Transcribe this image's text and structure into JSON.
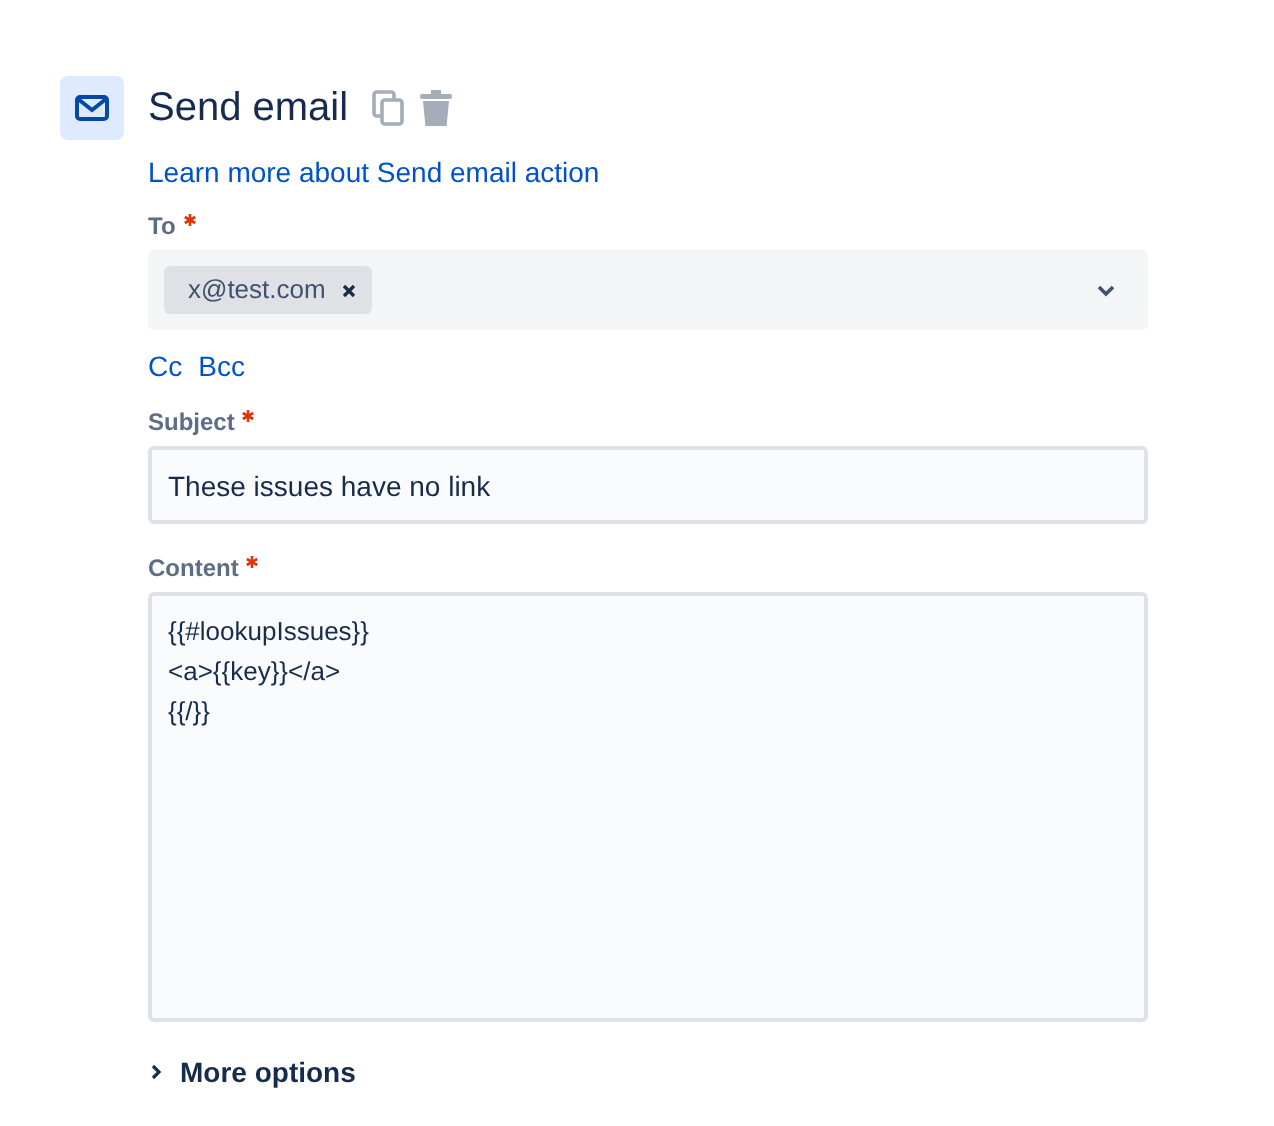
{
  "action": {
    "title": "Send email",
    "help_link": "Learn more about Send email action"
  },
  "to": {
    "label": "To",
    "required": true,
    "recipients": [
      "x@test.com"
    ]
  },
  "copy_links": [
    "Cc",
    "Bcc"
  ],
  "subject": {
    "label": "Subject",
    "required": true,
    "value": "These issues have no link"
  },
  "content": {
    "label": "Content",
    "required": true,
    "value": "{{#lookupIssues}}\n<a>{{key}}</a>\n{{/}}"
  },
  "more_options": {
    "label": "More options",
    "expanded": false
  }
}
